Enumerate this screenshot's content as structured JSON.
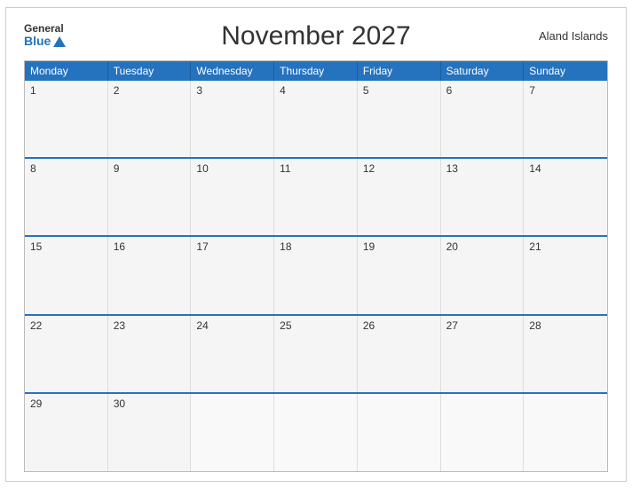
{
  "header": {
    "title": "November 2027",
    "region": "Aland Islands",
    "logo_general": "General",
    "logo_blue": "Blue"
  },
  "days": [
    "Monday",
    "Tuesday",
    "Wednesday",
    "Thursday",
    "Friday",
    "Saturday",
    "Sunday"
  ],
  "weeks": [
    [
      {
        "num": "1",
        "empty": false
      },
      {
        "num": "2",
        "empty": false
      },
      {
        "num": "3",
        "empty": false
      },
      {
        "num": "4",
        "empty": false
      },
      {
        "num": "5",
        "empty": false
      },
      {
        "num": "6",
        "empty": false
      },
      {
        "num": "7",
        "empty": false
      }
    ],
    [
      {
        "num": "8",
        "empty": false
      },
      {
        "num": "9",
        "empty": false
      },
      {
        "num": "10",
        "empty": false
      },
      {
        "num": "11",
        "empty": false
      },
      {
        "num": "12",
        "empty": false
      },
      {
        "num": "13",
        "empty": false
      },
      {
        "num": "14",
        "empty": false
      }
    ],
    [
      {
        "num": "15",
        "empty": false
      },
      {
        "num": "16",
        "empty": false
      },
      {
        "num": "17",
        "empty": false
      },
      {
        "num": "18",
        "empty": false
      },
      {
        "num": "19",
        "empty": false
      },
      {
        "num": "20",
        "empty": false
      },
      {
        "num": "21",
        "empty": false
      }
    ],
    [
      {
        "num": "22",
        "empty": false
      },
      {
        "num": "23",
        "empty": false
      },
      {
        "num": "24",
        "empty": false
      },
      {
        "num": "25",
        "empty": false
      },
      {
        "num": "26",
        "empty": false
      },
      {
        "num": "27",
        "empty": false
      },
      {
        "num": "28",
        "empty": false
      }
    ],
    [
      {
        "num": "29",
        "empty": false
      },
      {
        "num": "30",
        "empty": false
      },
      {
        "num": "",
        "empty": true
      },
      {
        "num": "",
        "empty": true
      },
      {
        "num": "",
        "empty": true
      },
      {
        "num": "",
        "empty": true
      },
      {
        "num": "",
        "empty": true
      }
    ]
  ]
}
